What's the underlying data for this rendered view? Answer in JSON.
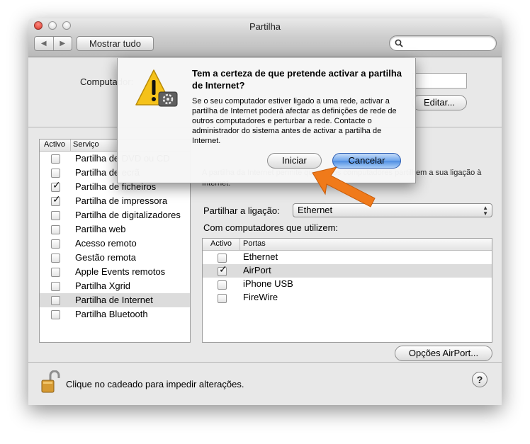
{
  "window": {
    "title": "Partilha"
  },
  "toolbar": {
    "back_glyph": "◀",
    "forward_glyph": "▶",
    "show_all_label": "Mostrar tudo",
    "search_placeholder": ""
  },
  "header": {
    "computer_name_label": "Computador:",
    "computer_name_value": "",
    "edit_label": "Editar..."
  },
  "services": {
    "col_active": "Activo",
    "col_service": "Serviço",
    "items": [
      {
        "label": "Partilha de DVD ou CD",
        "checked": false,
        "selected": false
      },
      {
        "label": "Partilha de ecrã",
        "checked": false,
        "selected": false
      },
      {
        "label": "Partilha de ficheiros",
        "checked": true,
        "selected": false
      },
      {
        "label": "Partilha de impressora",
        "checked": true,
        "selected": false
      },
      {
        "label": "Partilha de digitalizadores",
        "checked": false,
        "selected": false
      },
      {
        "label": "Partilha web",
        "checked": false,
        "selected": false
      },
      {
        "label": "Acesso remoto",
        "checked": false,
        "selected": false
      },
      {
        "label": "Gestão remota",
        "checked": false,
        "selected": false
      },
      {
        "label": "Apple Events remotos",
        "checked": false,
        "selected": false
      },
      {
        "label": "Partilha Xgrid",
        "checked": false,
        "selected": false
      },
      {
        "label": "Partilha de Internet",
        "checked": false,
        "selected": true
      },
      {
        "label": "Partilha Bluetooth",
        "checked": false,
        "selected": false
      }
    ]
  },
  "detail": {
    "description": "A partilha da Internet permite que outros computadores partilhem a sua ligação à Internet.",
    "share_from_label": "Partilhar a ligação:",
    "share_from_value": "Ethernet",
    "to_computers_label": "Com computadores que utilizem:",
    "col_active": "Activo",
    "col_ports": "Portas",
    "ports": [
      {
        "label": "Ethernet",
        "checked": false,
        "selected": false
      },
      {
        "label": "AirPort",
        "checked": true,
        "selected": true
      },
      {
        "label": "iPhone USB",
        "checked": false,
        "selected": false
      },
      {
        "label": "FireWire",
        "checked": false,
        "selected": false
      }
    ],
    "airport_options_label": "Opções AirPort..."
  },
  "footer": {
    "lock_text": "Clique no cadeado para impedir alterações.",
    "help_label": "?"
  },
  "dialog": {
    "title": "Tem a certeza de que pretende activar a partilha de Internet?",
    "message": "Se o seu computador estiver ligado a uma rede, activar a partilha de Internet poderá afectar as definições de rede de outros computadores e perturbar a rede. Contacte o administrador do sistema antes de activar a partilha de Internet.",
    "start_label": "Iniciar",
    "cancel_label": "Cancelar"
  },
  "colors": {
    "arrow": "#f07a1a",
    "default_button": "#5a97e6",
    "selection": "#dcdcdc"
  }
}
